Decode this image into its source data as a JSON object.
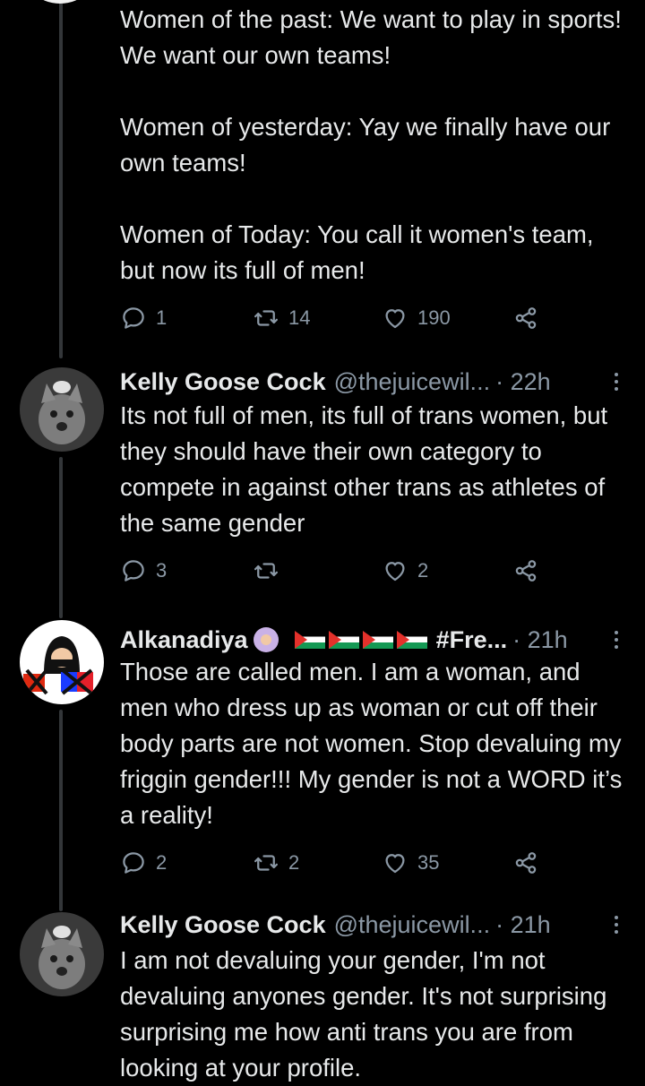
{
  "tweets": [
    {
      "body": "Women of the past: We want to play in sports! We want our own teams!\n\nWomen of yesterday:  Yay we finally have our own teams!\n\nWomen of Today: You call it women's team, but now its full of men!",
      "replies": "1",
      "retweets": "14",
      "likes": "190"
    },
    {
      "name": "Kelly Goose Cock",
      "handle": "@thejuicewil...",
      "time": "· 22h",
      "body": "Its not full of men, its full of trans women, but they should have their own category to compete in against other trans as athletes of the same gender",
      "replies": "3",
      "retweets": "",
      "likes": "2"
    },
    {
      "name": "Alkanadiya",
      "emoji": "person-with-headscarf-emoji",
      "flags": [
        "palestine-flag",
        "palestine-flag",
        "palestine-flag",
        "palestine-flag"
      ],
      "hashtag": "#Fre...",
      "time": "· 21h",
      "body": "Those are called men. I am a woman, and men who dress up as woman or cut off their body parts are not women. Stop devaluing my friggin gender!!! My gender is not a WORD it’s a reality!",
      "replies": "2",
      "retweets": "2",
      "likes": "35"
    },
    {
      "name": "Kelly Goose Cock",
      "handle": "@thejuicewil...",
      "time": "· 21h",
      "body": "I am not devaluing your gender, I'm not devaluing anyones gender. It's not surprising surprising me how anti trans you are from looking at your profile."
    }
  ],
  "icons": {
    "reply": "reply-icon",
    "retweet": "retweet-icon",
    "like": "like-icon",
    "share": "share-icon",
    "more": "more-options-icon"
  },
  "colors": {
    "background": "#000000",
    "text": "#e7e9ea",
    "secondary": "#8b98a5",
    "thread_line": "#333639"
  }
}
